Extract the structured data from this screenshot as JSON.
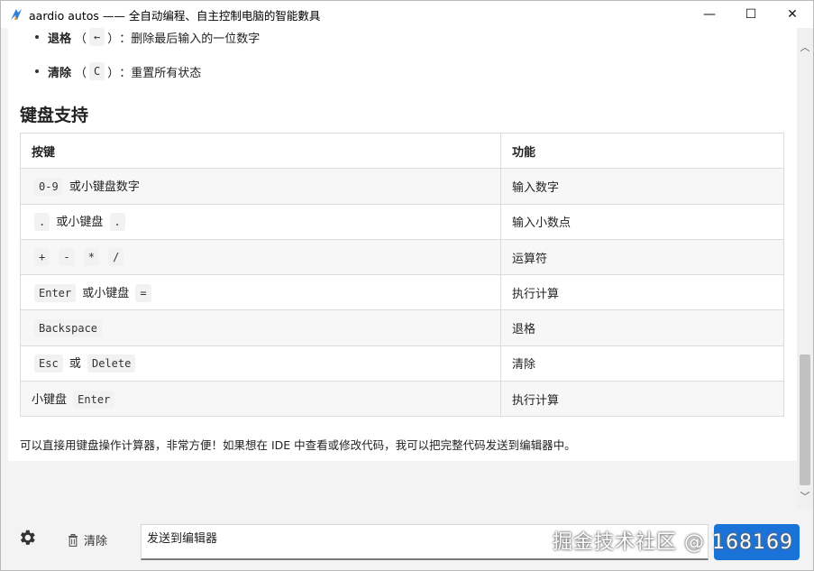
{
  "window": {
    "title": "aardio autos —— 全自动编程、自主控制电脑的智能數具",
    "controls": {
      "minimize": "—",
      "maximize": "☐",
      "close": "✕"
    }
  },
  "bullets": [
    {
      "label": "退格",
      "open": "（",
      "key": "←",
      "close": "）",
      "sep": "：",
      "desc": "删除最后输入的一位数字"
    },
    {
      "label": "清除",
      "open": "（",
      "key": "C",
      "close": "）",
      "sep": "：",
      "desc": "重置所有状态"
    }
  ],
  "section_heading": "键盘支持",
  "table": {
    "headers": [
      "按键",
      "功能"
    ],
    "rows": [
      {
        "keys": [
          "0-9"
        ],
        "text_after": "或小键盘数字",
        "func": "输入数字"
      },
      {
        "keys_mixed": [
          ".",
          "或小键盘",
          "."
        ],
        "func": "输入小数点"
      },
      {
        "keys": [
          "+",
          "-",
          "*",
          "/"
        ],
        "func": "运算符"
      },
      {
        "keys_mixed": [
          "Enter",
          "或小键盘",
          "="
        ],
        "func": "执行计算"
      },
      {
        "keys": [
          "Backspace"
        ],
        "func": "退格"
      },
      {
        "keys_mixed": [
          "Esc",
          "或",
          "Delete"
        ],
        "func": "清除"
      },
      {
        "keys_mixed": [
          "小键盘",
          "Enter"
        ],
        "func": "执行计算"
      }
    ]
  },
  "footer_note": "可以直接用键盘操作计算器，非常方便！如果想在 IDE 中查看或修改代码，我可以把完整代码发送到编辑器中。",
  "bottom": {
    "clear_label": "清除",
    "input_value": "发送到编辑器",
    "watermark": "掘金技术社区 @ 168169"
  },
  "colors": {
    "accent": "#1a73d9"
  },
  "icons": {
    "settings": "gear-icon",
    "clear": "trash-icon",
    "app": "aardio-icon"
  }
}
